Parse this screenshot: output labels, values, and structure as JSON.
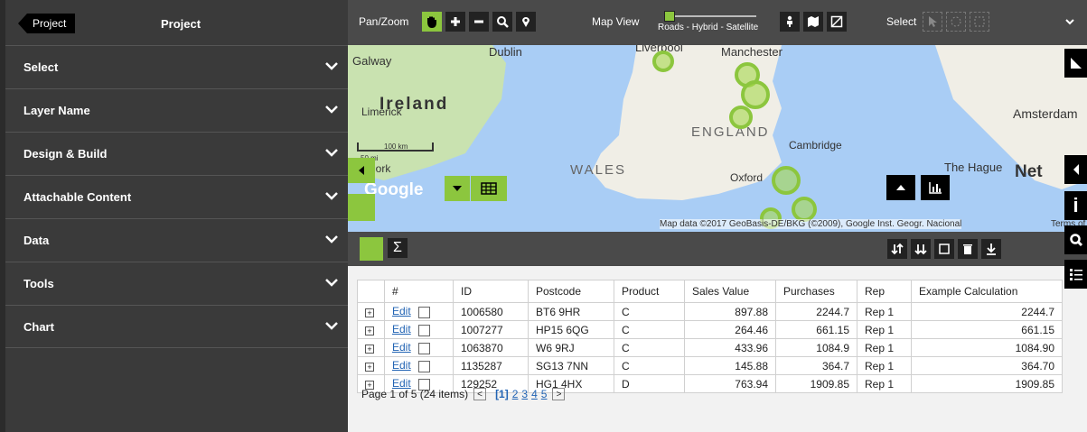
{
  "sidebar": {
    "back_label": "Project",
    "title": "Project",
    "items": [
      {
        "label": "Select"
      },
      {
        "label": "Layer Name"
      },
      {
        "label": "Design & Build"
      },
      {
        "label": "Attachable Content"
      },
      {
        "label": "Data"
      },
      {
        "label": "Tools"
      },
      {
        "label": "Chart"
      }
    ]
  },
  "toolbar": {
    "panzoom_label": "Pan/Zoom",
    "mapview_label": "Map View",
    "slider_label": "Roads - Hybrid - Satellite",
    "select_label": "Select",
    "accent": "#8cc63e"
  },
  "map": {
    "labels": {
      "galway": "Galway",
      "ireland": "Ireland",
      "dublin": "Dublin",
      "limerick": "Limerick",
      "cork": "Cork",
      "liverpool": "Liverpool",
      "manchester": "Manchester",
      "england": "ENGLAND",
      "cambridge": "Cambridge",
      "wales": "WALES",
      "oxford": "Oxford",
      "amsterdam": "Amsterdam",
      "hague": "The Hague",
      "net": "Net",
      "google": "Google"
    },
    "scale_km": "100 km",
    "scale_mi": "50 mi",
    "attribution": "Map data ©2017 GeoBasis-DE/BKG (©2009), Google Inst. Geogr. Nacional",
    "terms": "Terms of"
  },
  "grid": {
    "columns": [
      "#",
      "ID",
      "Postcode",
      "Product",
      "Sales Value",
      "Purchases",
      "Rep",
      "Example Calculation"
    ],
    "edit_label": "Edit",
    "rows": [
      {
        "id": "1006580",
        "postcode": "BT6 9HR",
        "product": "C",
        "sales": "897.88",
        "purchases": "2244.7",
        "rep": "Rep 1",
        "calc": "2244.7"
      },
      {
        "id": "1007277",
        "postcode": "HP15 6QG",
        "product": "C",
        "sales": "264.46",
        "purchases": "661.15",
        "rep": "Rep 1",
        "calc": "661.15"
      },
      {
        "id": "1063870",
        "postcode": "W6 9RJ",
        "product": "C",
        "sales": "433.96",
        "purchases": "1084.9",
        "rep": "Rep 1",
        "calc": "1084.90"
      },
      {
        "id": "1135287",
        "postcode": "SG13 7NN",
        "product": "C",
        "sales": "145.88",
        "purchases": "364.7",
        "rep": "Rep 1",
        "calc": "364.70"
      },
      {
        "id": "129252",
        "postcode": "HG1 4HX",
        "product": "D",
        "sales": "763.94",
        "purchases": "1909.85",
        "rep": "Rep 1",
        "calc": "1909.85"
      }
    ],
    "pager": {
      "summary": "Page 1 of 5 (24 items)",
      "pages": [
        "[1]",
        "2",
        "3",
        "4",
        "5"
      ]
    }
  },
  "right": {
    "info_label": "i"
  }
}
